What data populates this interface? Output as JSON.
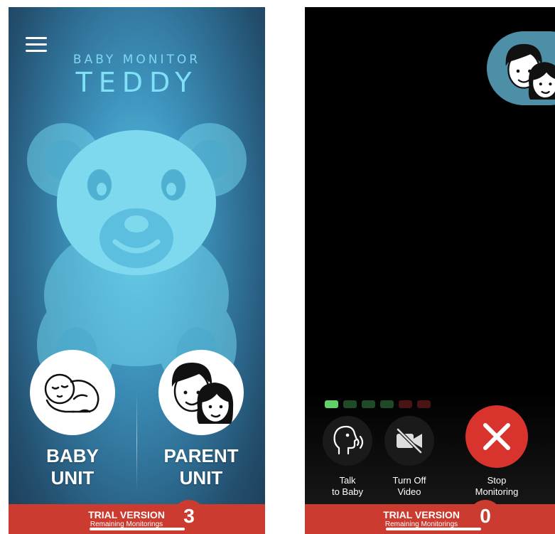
{
  "left_screen": {
    "brand_small": "BABY MONITOR",
    "brand_large": "TEDDY",
    "baby_unit": {
      "line1": "BABY",
      "line2": "UNIT"
    },
    "parent_unit": {
      "line1": "PARENT",
      "line2": "UNIT"
    },
    "trial": {
      "title": "TRIAL VERSION",
      "subtitle": "Remaining Monitorings",
      "count": "3"
    }
  },
  "right_screen": {
    "audio_levels": {
      "colors": [
        "#5fd26a",
        "#1f4a26",
        "#1f4a26",
        "#1f4a26",
        "#4a1414",
        "#4a1414"
      ]
    },
    "controls": {
      "talk": {
        "line1": "Talk",
        "line2": "to Baby",
        "icon": "speaking-head-icon"
      },
      "video": {
        "line1": "Turn Off",
        "line2": "Video",
        "icon": "video-off-icon"
      },
      "stop": {
        "line1": "Stop",
        "line2": "Monitoring",
        "icon": "close-x-icon"
      }
    },
    "trial": {
      "title": "TRIAL VERSION",
      "subtitle": "Remaining Monitorings",
      "count": "0"
    }
  },
  "colors": {
    "trial_bar": "#cc3b2f",
    "stop_button": "#d8342d",
    "brand_text": "#7fe0f6"
  }
}
